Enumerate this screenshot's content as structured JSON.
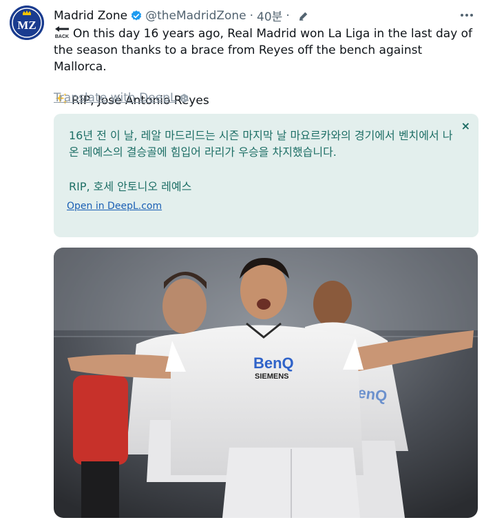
{
  "author": {
    "name": "Madrid Zone",
    "handle": "@theMadridZone",
    "time": "40분",
    "avatar_text": "MZ"
  },
  "tweet": {
    "line1": "On this day 16 years ago, Real Madrid won La Liga in the last day of the season thanks to a brace from Reyes off the bench against Mallorca.",
    "line2": "RIP, José Antonio Reyes",
    "back_emoji_label": "BACK"
  },
  "translate_link": "Translate with DeepL",
  "deepl_box": {
    "translation_1": "16년 전 이 날, 레알 마드리드는 시즌 마지막 날 마요르카와의 경기에서 벤치에서 나온 레예스의 결승골에 힘입어 라리가 우승을 차지했습니다.",
    "translation_2": "RIP, 호세 안토니오 레예스",
    "open_link": "Open in DeepL.com",
    "close_glyph": "×"
  },
  "photo": {
    "jersey_sponsor_1": "BenQ",
    "jersey_sponsor_2": "SIEMENS"
  },
  "colors": {
    "verified": "#1d9bf0",
    "deepl_box_bg": "#e3efed",
    "deepl_text": "#1e6f66",
    "link": "#1a5fb4",
    "muted": "#536471"
  }
}
